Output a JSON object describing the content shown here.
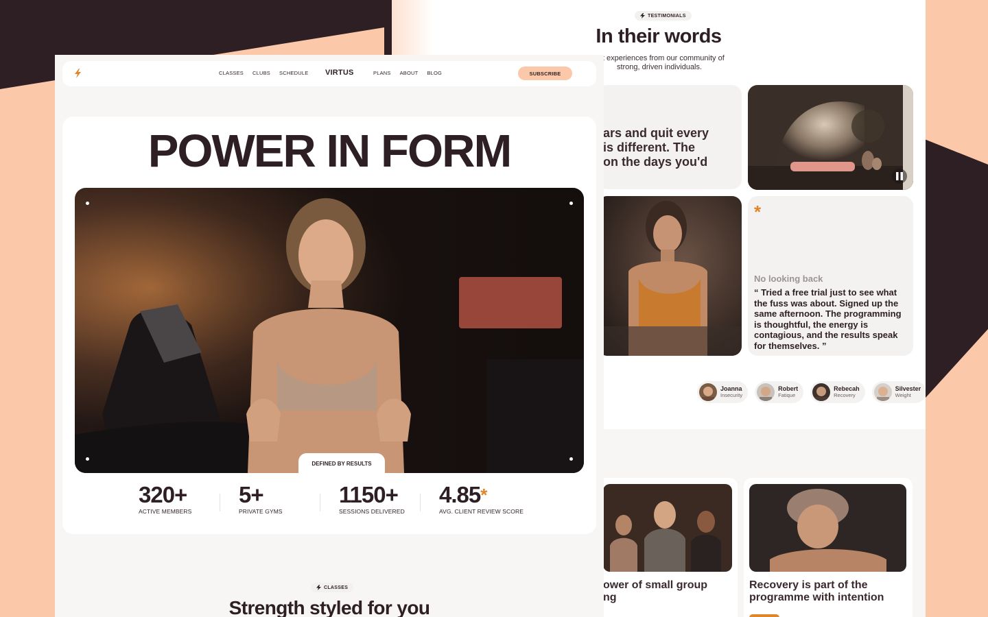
{
  "colors": {
    "dark": "#2d1f23",
    "peach": "#fbc9a9",
    "accent": "#e0862a",
    "panel": "#f7f6f5"
  },
  "testimonials": {
    "tag": "TESTIMONIALS",
    "title": "In their words",
    "subtitle": "est experiences from our community of strong, driven individuals.",
    "quote_partial": "ars and quit every\n is different. The\non the days you'd",
    "highlight": {
      "label": "No looking back",
      "quote": "“ Tried a free trial just to see what the fuss was about. Signed up the same afternoon. The programming is thoughtful, the energy is contagious, and the results speak for themselves. ”"
    },
    "people": [
      {
        "name": "Joanna",
        "role": "Insecurity"
      },
      {
        "name": "Robert",
        "role": "Fatique"
      },
      {
        "name": "Rebecah",
        "role": "Recovery"
      },
      {
        "name": "Silvester",
        "role": "Weight"
      }
    ],
    "video_icon": "pause-icon"
  },
  "blog": [
    {
      "title": "ower of small group\nng",
      "date": ""
    },
    {
      "title": "Recovery is part of the programme with intention",
      "date": ""
    }
  ],
  "nav": {
    "logo_icon": "bolt-icon",
    "left_links": [
      "CLASSES",
      "CLUBS",
      "SCHEDULE"
    ],
    "brand": "VIRTUS",
    "right_links": [
      "PLANS",
      "ABOUT",
      "BLOG"
    ],
    "subscribe": "SUBSCRIBE"
  },
  "hero": {
    "title": "POWER IN FORM",
    "tab_label": "DEFINED BY RESULTS"
  },
  "stats": [
    {
      "value": "320+",
      "label": "ACTIVE MEMBERS"
    },
    {
      "value": "5+",
      "label": "PRIVATE GYMS"
    },
    {
      "value": "1150+",
      "label": "SESSIONS DELIVERED"
    },
    {
      "value": "4.85",
      "suffix": "*",
      "label": "AVG. CLIENT REVIEW SCORE"
    }
  ],
  "classes": {
    "tag": "CLASSES",
    "title": "Strength styled for you"
  }
}
